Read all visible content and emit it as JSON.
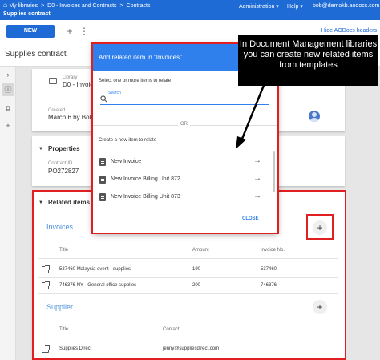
{
  "breadcrumb": [
    "My libraries",
    "D0 - Invoices and Contracts",
    "Contracts",
    "Supplies contract"
  ],
  "top_menu": {
    "administration": "Administration",
    "help": "Help",
    "user": "bob@demokb.aodocs.com"
  },
  "toolbar": {
    "new_label": "NEW",
    "hide_headers": "Hide AODocs headers"
  },
  "document": {
    "title": "Supplies contract",
    "library_label": "Library",
    "library_value": "D0 - Invoices",
    "created_label": "Created",
    "created_value": "March 6 by Bob D"
  },
  "properties": {
    "title": "Properties",
    "contract_id_label": "Contract ID",
    "contract_id_value": "PO272827"
  },
  "related": {
    "title": "Related items",
    "invoices": {
      "title": "Invoices",
      "columns": [
        "Title",
        "Amount",
        "Invoice No."
      ],
      "rows": [
        [
          "537460 Malaysia event - supplies",
          "190",
          "537460"
        ],
        [
          "746376 NY - General office supplies",
          "200",
          "746376"
        ]
      ]
    },
    "supplier": {
      "title": "Supplier",
      "columns": [
        "Title",
        "Contact"
      ],
      "rows": [
        [
          "Supplies Direct",
          "jenny@suppliesdirect.com"
        ]
      ]
    }
  },
  "modal": {
    "title": "Add related item in \"Invoices\"",
    "select_text": "Select one or more items to relate",
    "search_label": "Search",
    "search_value": "",
    "or_text": "OR",
    "create_text": "Create a new item to relate",
    "templates": [
      "New Invoice",
      "New Invoice Billing Unit 872",
      "New Invoice Billing Unit 873"
    ],
    "close_label": "CLOSE"
  },
  "callout": {
    "text": "In Document Management libraries you can create new related items from templates"
  },
  "colors": {
    "accent": "#1e6bd6",
    "modal_header": "#2f80ed",
    "highlight": "#e02020",
    "group_title": "#4a90d9"
  },
  "icons": [
    "home-icon",
    "add-person-icon",
    "more-vert-icon",
    "chevron-right-icon",
    "info-icon",
    "copy-icon",
    "plus-icon",
    "folder-icon",
    "search-icon",
    "document-icon",
    "arrow-right-icon",
    "open-external-icon",
    "avatar-icon"
  ]
}
